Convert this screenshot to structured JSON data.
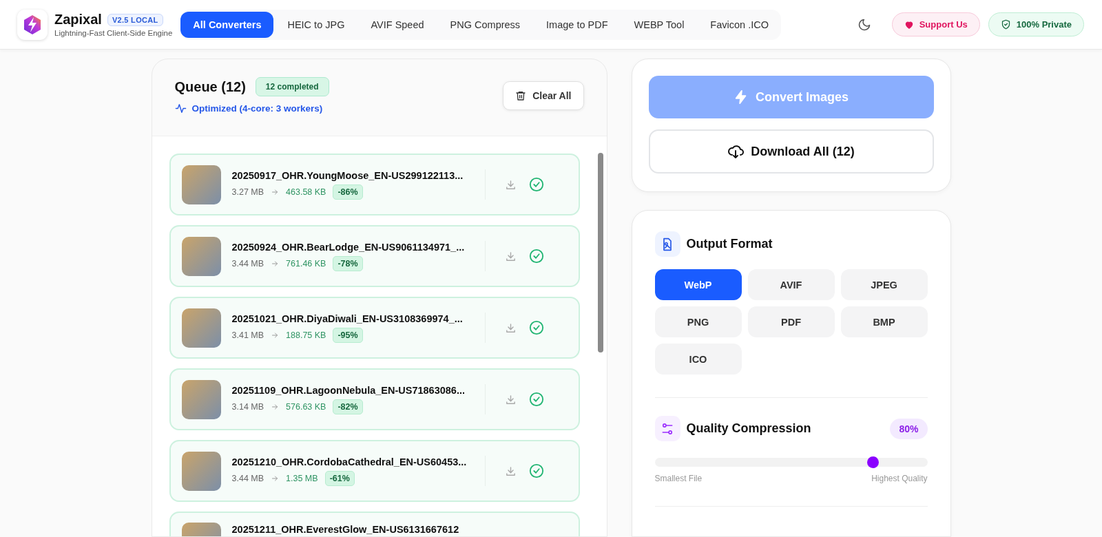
{
  "header": {
    "brand": "Zapixal",
    "version_badge": "V2.5 LOCAL",
    "tagline": "Lightning-Fast Client-Side Engine",
    "nav": [
      {
        "label": "All Converters",
        "selected": true
      },
      {
        "label": "HEIC to JPG",
        "selected": false
      },
      {
        "label": "AVIF Speed",
        "selected": false
      },
      {
        "label": "PNG Compress",
        "selected": false
      },
      {
        "label": "Image to PDF",
        "selected": false
      },
      {
        "label": "WEBP Tool",
        "selected": false
      },
      {
        "label": "Favicon .ICO",
        "selected": false
      }
    ],
    "support_button": "Support Us",
    "privacy_badge": "100% Private"
  },
  "queue": {
    "title": "Queue (12)",
    "status_badge": "12 completed",
    "optimization": "Optimized (4-core: 3 workers)",
    "clear_button": "Clear All",
    "files": [
      {
        "name": "20250917_OHR.YoungMoose_EN-US299122113...",
        "original_size": "3.27 MB",
        "converted_size": "463.58 KB",
        "reduction": "-86%",
        "completed": true
      },
      {
        "name": "20250924_OHR.BearLodge_EN-US9061134971_...",
        "original_size": "3.44 MB",
        "converted_size": "761.46 KB",
        "reduction": "-78%",
        "completed": true
      },
      {
        "name": "20251021_OHR.DiyaDiwali_EN-US3108369974_...",
        "original_size": "3.41 MB",
        "converted_size": "188.75 KB",
        "reduction": "-95%",
        "completed": true
      },
      {
        "name": "20251109_OHR.LagoonNebula_EN-US71863086...",
        "original_size": "3.14 MB",
        "converted_size": "576.63 KB",
        "reduction": "-82%",
        "completed": true
      },
      {
        "name": "20251210_OHR.CordobaCathedral_EN-US60453...",
        "original_size": "3.44 MB",
        "converted_size": "1.35 MB",
        "reduction": "-61%",
        "completed": true
      },
      {
        "name": "20251211_OHR.EverestGlow_EN-US6131667612"
      }
    ]
  },
  "actions": {
    "convert_button": {
      "label": "Convert Images",
      "disabled": true
    },
    "download_button": "Download All (12)"
  },
  "output_format": {
    "title": "Output Format",
    "options": [
      {
        "label": "WebP",
        "selected": true
      },
      {
        "label": "AVIF",
        "selected": false
      },
      {
        "label": "JPEG",
        "selected": false
      },
      {
        "label": "PNG",
        "selected": false
      },
      {
        "label": "PDF",
        "selected": false
      },
      {
        "label": "BMP",
        "selected": false
      },
      {
        "label": "ICO",
        "selected": false
      }
    ]
  },
  "quality": {
    "title": "Quality Compression",
    "value": "80%",
    "level": 0.8,
    "min_label": "Smallest File",
    "max_label": "Highest Quality"
  }
}
